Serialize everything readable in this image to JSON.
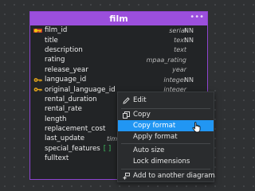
{
  "table": {
    "title": "film",
    "menu_glyph": "•••",
    "columns": [
      {
        "name": "film_id",
        "type": "serial",
        "nn": "NN",
        "key": "primary"
      },
      {
        "name": "title",
        "type": "text",
        "nn": "NN",
        "key": ""
      },
      {
        "name": "description",
        "type": "text",
        "nn": "",
        "key": ""
      },
      {
        "name": "rating",
        "type": "mpaa_rating",
        "nn": "",
        "key": ""
      },
      {
        "name": "release_year",
        "type": "year",
        "nn": "",
        "key": ""
      },
      {
        "name": "language_id",
        "type": "integer",
        "nn": "NN",
        "key": "foreign"
      },
      {
        "name": "original_language_id",
        "type": "integer",
        "nn": "",
        "key": "foreign"
      },
      {
        "name": "rental_duration",
        "type": "",
        "nn": "",
        "key": ""
      },
      {
        "name": "rental_rate",
        "type": "",
        "nn": "",
        "key": ""
      },
      {
        "name": "length",
        "type": "",
        "nn": "",
        "key": ""
      },
      {
        "name": "replacement_cost",
        "type": "",
        "nn": "",
        "key": ""
      },
      {
        "name": "last_update",
        "type": "timesta",
        "nn": "",
        "key": ""
      },
      {
        "name": "special_features",
        "type": "",
        "nn": "",
        "key": "",
        "array": "[ ]"
      },
      {
        "name": "fulltext",
        "type": "",
        "nn": "",
        "key": ""
      }
    ]
  },
  "context_menu": {
    "edit": "Edit",
    "copy": "Copy",
    "copy_format": "Copy format",
    "apply_format": "Apply format",
    "auto_size": "Auto size",
    "lock_dimensions": "Lock dimensions",
    "add_to_diagram": "Add to another diagram"
  },
  "colors": {
    "accent": "#9b4fdc",
    "highlight": "#2196f3",
    "primary_key": "#e0a21a",
    "foreign_key": "#e0a21a"
  }
}
